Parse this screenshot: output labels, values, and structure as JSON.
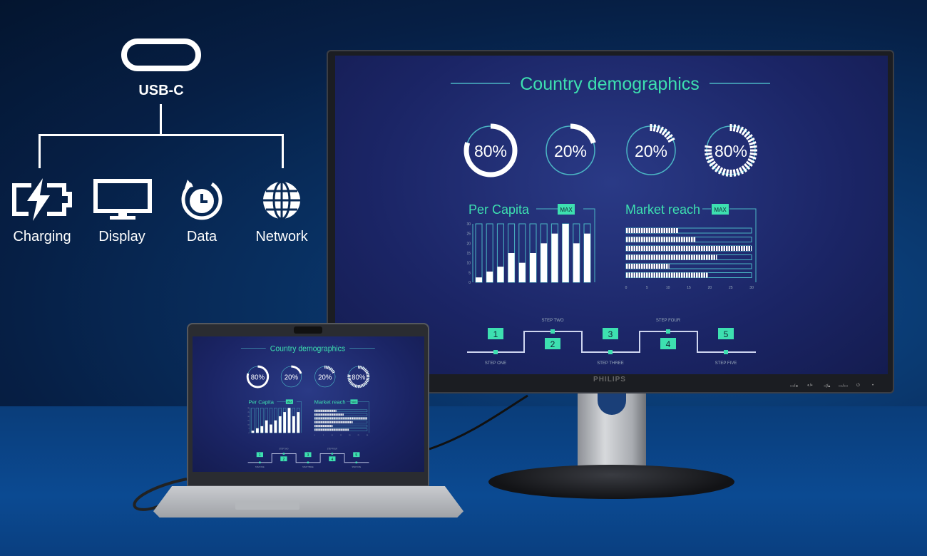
{
  "usb_diagram": {
    "connector_label": "USB-C",
    "features": [
      {
        "label": "Charging",
        "icon": "battery-charging-icon"
      },
      {
        "label": "Display",
        "icon": "monitor-icon"
      },
      {
        "label": "Data",
        "icon": "data-sync-icon"
      },
      {
        "label": "Network",
        "icon": "globe-icon"
      }
    ]
  },
  "monitor": {
    "brand": "PHILIPS"
  },
  "dashboard": {
    "title": "Country demographics",
    "rings": [
      {
        "label": "80%",
        "value": 80,
        "style": "solid"
      },
      {
        "label": "20%",
        "value": 20,
        "style": "solid"
      },
      {
        "label": "20%",
        "value": 20,
        "style": "dashed"
      },
      {
        "label": "80%",
        "value": 80,
        "style": "dashed"
      }
    ],
    "per_capita": {
      "title": "Per Capita",
      "badge": "MAX",
      "type": "bar",
      "yticks": [
        "0",
        "5",
        "10",
        "15",
        "20",
        "25",
        "30"
      ],
      "ylim": [
        0,
        30
      ],
      "values": [
        2.5,
        5.5,
        8,
        15,
        10,
        15,
        20,
        25,
        30,
        20,
        25
      ]
    },
    "market_reach": {
      "title": "Market reach",
      "badge": "MAX",
      "type": "bar-horizontal",
      "xticks": [
        "0",
        "5",
        "10",
        "15",
        "20",
        "25",
        "30"
      ],
      "xlim": [
        0,
        30
      ],
      "values": [
        12,
        16,
        29,
        21,
        10,
        19
      ]
    },
    "steps": [
      {
        "num": "1",
        "label": "STEP ONE"
      },
      {
        "num": "2",
        "label": "STEP TWO"
      },
      {
        "num": "3",
        "label": "STEP THREE"
      },
      {
        "num": "4",
        "label": "STEP FOUR"
      },
      {
        "num": "5",
        "label": "STEP FIVE"
      }
    ],
    "colors": {
      "accent": "#3de0b0",
      "line": "#4bb6c4",
      "bg": "#1b2566"
    }
  }
}
